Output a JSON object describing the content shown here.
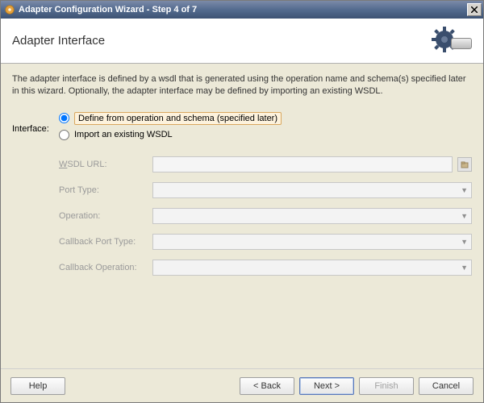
{
  "window": {
    "title": "Adapter Configuration Wizard - Step 4 of 7"
  },
  "header": {
    "title": "Adapter Interface"
  },
  "description": "The adapter interface is defined by a wsdl that is generated using the operation name and schema(s) specified later in this wizard.  Optionally, the adapter interface may be defined by importing an existing WSDL.",
  "form": {
    "interface_label": "Interface:",
    "radios": {
      "define": "Define from operation and schema (specified later)",
      "import": "Import an existing WSDL"
    },
    "fields": {
      "wsdl_url_label": "WSDL URL:",
      "wsdl_url_value": "",
      "port_type_label": "Port Type:",
      "operation_label": "Operation:",
      "callback_port_label": "Callback Port Type:",
      "callback_op_label": "Callback Operation:"
    }
  },
  "buttons": {
    "help": "Help",
    "back": "< Back",
    "next": "Next >",
    "finish": "Finish",
    "cancel": "Cancel"
  }
}
